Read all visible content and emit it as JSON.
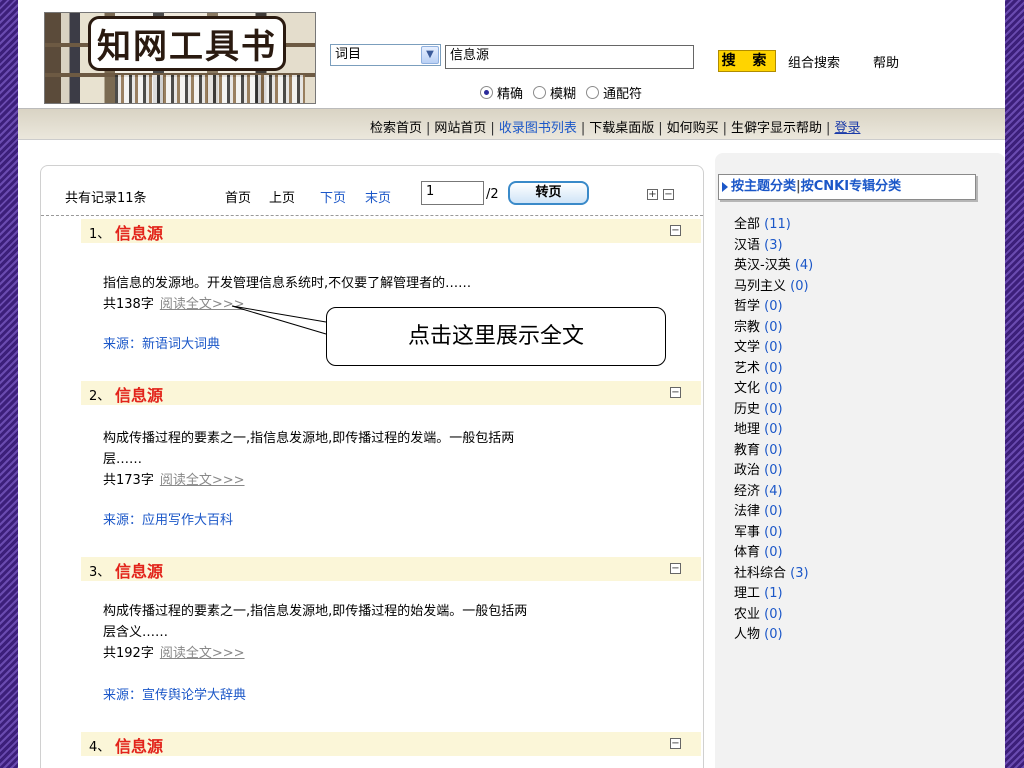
{
  "header": {
    "logo_text": "知网工具书",
    "search_field": "词目",
    "search_value": "信息源",
    "radio_options": [
      {
        "label": "精确",
        "selected": true
      },
      {
        "label": "模糊",
        "selected": false
      },
      {
        "label": "通配符",
        "selected": false
      }
    ],
    "search_button": "搜 索",
    "combo_search": "组合搜索",
    "help": "帮助"
  },
  "nav": {
    "items": [
      "检索首页",
      "网站首页",
      "收录图书列表",
      "下载桌面版",
      "如何购买",
      "生僻字显示帮助"
    ],
    "login": "登录"
  },
  "pager": {
    "total": "共有记录11条",
    "first": "首页",
    "prev": "上页",
    "next": "下页",
    "last": "末页",
    "page_value": "1",
    "page_total": "/2",
    "jump": "转页"
  },
  "entries": [
    {
      "num": "1、",
      "title": "信息源",
      "summary": "指信息的发源地。开发管理信息系统时,不仅要了解管理者的……",
      "summary2": "",
      "words": "共138字",
      "read": "阅读全文>>>",
      "source": "来源：新语词大词典"
    },
    {
      "num": "2、",
      "title": "信息源",
      "summary": "构成传播过程的要素之一,指信息发源地,即传播过程的发端。一般包括两",
      "summary2": "层……",
      "words": "共173字",
      "read": "阅读全文>>>",
      "source": "来源：应用写作大百科"
    },
    {
      "num": "3、",
      "title": "信息源",
      "summary": "构成传播过程的要素之一,指信息发源地,即传播过程的始发端。一般包括两",
      "summary2": "层含义……",
      "words": "共192字",
      "read": "阅读全文>>>",
      "source": "来源：宣传舆论学大辞典"
    },
    {
      "num": "4、",
      "title": "信息源"
    }
  ],
  "callout": "点击这里展示全文",
  "sidebar": {
    "tab_active": "按主题分类",
    "tab_inactive": "按CNKI专辑分类",
    "categories": [
      {
        "name": "全部",
        "count": "(11)"
      },
      {
        "name": "汉语",
        "count": "(3)"
      },
      {
        "name": "英汉-汉英",
        "count": "(4)"
      },
      {
        "name": "马列主义",
        "count": "(0)"
      },
      {
        "name": "哲学",
        "count": "(0)"
      },
      {
        "name": "宗教",
        "count": "(0)"
      },
      {
        "name": "文学",
        "count": "(0)"
      },
      {
        "name": "艺术",
        "count": "(0)"
      },
      {
        "name": "文化",
        "count": "(0)"
      },
      {
        "name": "历史",
        "count": "(0)"
      },
      {
        "name": "地理",
        "count": "(0)"
      },
      {
        "name": "教育",
        "count": "(0)"
      },
      {
        "name": "政治",
        "count": "(0)"
      },
      {
        "name": "经济",
        "count": "(4)"
      },
      {
        "name": "法律",
        "count": "(0)"
      },
      {
        "name": "军事",
        "count": "(0)"
      },
      {
        "name": "体育",
        "count": "(0)"
      },
      {
        "name": "社科综合",
        "count": "(3)"
      },
      {
        "name": "理工",
        "count": "(1)"
      },
      {
        "name": "农业",
        "count": "(0)"
      },
      {
        "name": "人物",
        "count": "(0)"
      }
    ]
  }
}
